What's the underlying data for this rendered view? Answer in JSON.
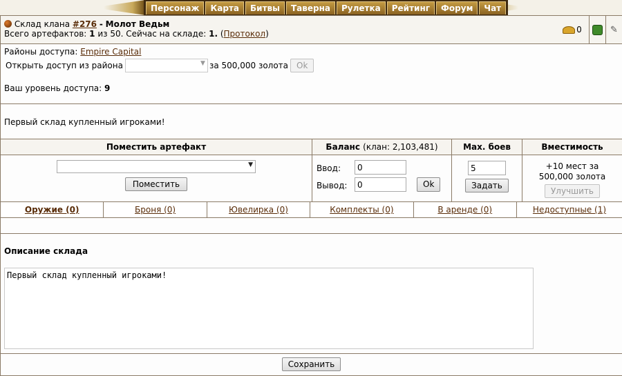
{
  "nav": {
    "items": [
      "Персонаж",
      "Карта",
      "Битвы",
      "Таверна",
      "Рулетка",
      "Рейтинг",
      "Форум",
      "Чат"
    ]
  },
  "header": {
    "prefix": "Склад клана",
    "clan_id": "#276",
    "sep": "-",
    "clan_name": "Молот Ведьм",
    "total_label": "Всего артефактов:",
    "total": "1",
    "of_label": "из 50. Сейчас на складе:",
    "on_hand": "1.",
    "protocol": "Протокол",
    "gold": "0"
  },
  "access": {
    "districts_label": "Районы доступа:",
    "district": "Empire Capital",
    "open_label": "Открыть доступ из района",
    "price_label": "за 500,000 золота",
    "ok": "Ok",
    "level_label": "Ваш уровень доступа:",
    "level": "9"
  },
  "description_text": "Первый склад купленный игроками!",
  "panel": {
    "put_header": "Поместить артефакт",
    "put_button": "Поместить",
    "balance_header": "Баланс",
    "balance_clan": "(клан: 2,103,481)",
    "deposit_label": "Ввод:",
    "deposit_value": "0",
    "withdraw_label": "Вывод:",
    "withdraw_value": "0",
    "ok": "Ok",
    "maxbattles_header": "Max. боев",
    "maxbattles_value": "5",
    "set_button": "Задать",
    "capacity_header": "Вместимость",
    "capacity_text": "+10 мест за 500,000 золота",
    "upgrade_button": "Улучшить"
  },
  "tabs": [
    "Оружие (0)",
    "Броня (0)",
    "Ювелирка (0)",
    "Комплекты (0)",
    "В аренде (0)",
    "Недоступные (1)"
  ],
  "description_section": {
    "title": "Описание склада",
    "text": "Первый склад купленный игроками!"
  },
  "save_button": "Сохранить"
}
